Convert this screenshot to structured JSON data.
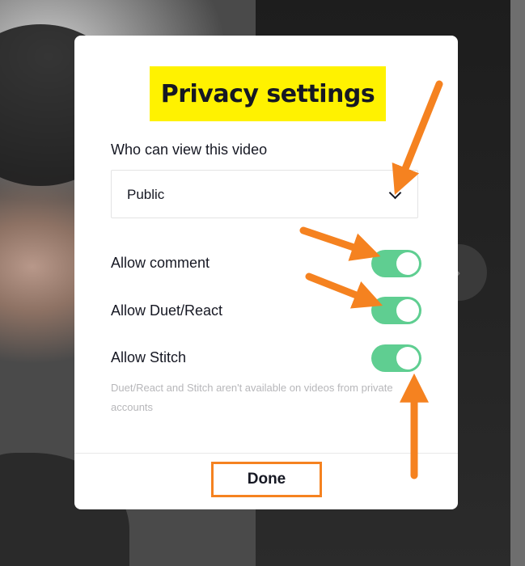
{
  "modal": {
    "title": "Privacy settings",
    "who_can_view_label": "Who can view this video",
    "who_can_view_value": "Public",
    "settings": [
      {
        "label": "Allow comment",
        "enabled": true
      },
      {
        "label": "Allow Duet/React",
        "enabled": true
      },
      {
        "label": "Allow Stitch",
        "enabled": true
      }
    ],
    "note": "Duet/React and Stitch aren't available on videos from private accounts",
    "done_label": "Done"
  },
  "colors": {
    "title_highlight": "#fff200",
    "toggle_on": "#5fce91",
    "annotation": "#f58220"
  },
  "icons": {
    "select_chevron": "chevron-down-icon",
    "background_nav": "chevron-right-icon"
  }
}
